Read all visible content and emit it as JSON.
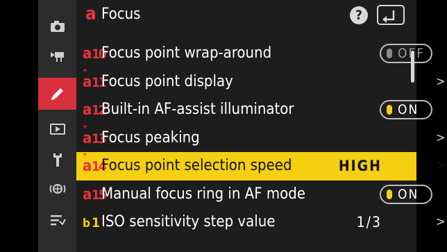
{
  "header": {
    "menu_letter": "a",
    "title": "Focus",
    "help_symbol": "?",
    "back_symbol": "⮌"
  },
  "sidebar": {
    "items": [
      {
        "icon": "camera-icon"
      },
      {
        "icon": "movie-camera-icon"
      },
      {
        "icon": "pencil-icon",
        "active": true
      },
      {
        "icon": "playback-icon"
      },
      {
        "icon": "wrench-icon"
      },
      {
        "icon": "network-icon"
      },
      {
        "icon": "my-menu-icon"
      }
    ]
  },
  "rows": [
    {
      "star": "",
      "code_letter": "a",
      "code_num": "10",
      "label": "Focus point wrap-around",
      "control": "toggle",
      "state": "OFF",
      "chevron": ""
    },
    {
      "star": "*",
      "code_letter": "a",
      "code_num": "11",
      "label": "Focus point display",
      "control": "none",
      "value": "",
      "chevron": ">"
    },
    {
      "star": "",
      "code_letter": "a",
      "code_num": "12",
      "label": "Built-in AF-assist illuminator",
      "control": "toggle",
      "state": "ON",
      "chevron": ""
    },
    {
      "star": "*",
      "code_letter": "a",
      "code_num": "13",
      "label": "Focus peaking",
      "control": "none",
      "value": "",
      "chevron": ">"
    },
    {
      "star": "*",
      "code_letter": "a",
      "code_num": "14",
      "label": "Focus point selection speed",
      "control": "value",
      "value": "HIGH",
      "chevron": ">",
      "highlighted": true
    },
    {
      "star": "",
      "code_letter": "a",
      "code_num": "15",
      "label": "Manual focus ring in AF mode",
      "control": "toggle",
      "state": "ON",
      "chevron": ""
    },
    {
      "star": "",
      "code_letter": "b",
      "code_num": "1",
      "label": "ISO sensitivity step value",
      "control": "value",
      "value": "1/3",
      "chevron": ">"
    }
  ],
  "colors": {
    "accent_red": "#e8323c",
    "highlight_yellow": "#f4cf12",
    "toggle_on": "#f4cf12",
    "toggle_off": "#8a8a8a"
  }
}
